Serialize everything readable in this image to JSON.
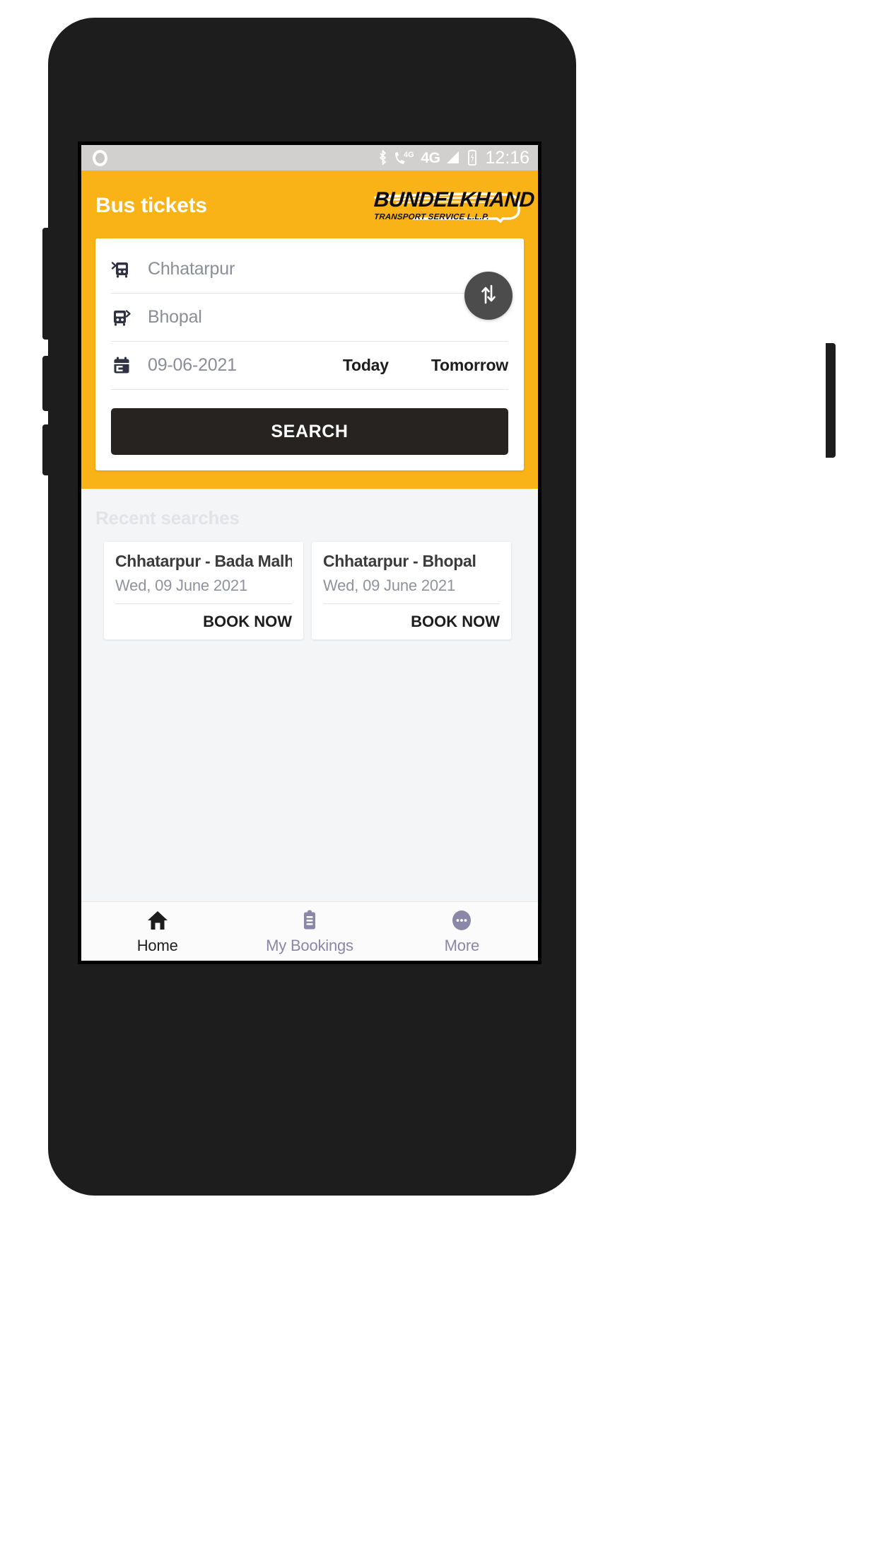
{
  "statusbar": {
    "time": "12:16",
    "network_label_1": "4G",
    "network_label_2": "4G",
    "icons": [
      "camera-circle-icon",
      "bluetooth-icon",
      "call-4g-icon",
      "signal-bars-icon",
      "battery-charging-icon"
    ]
  },
  "header": {
    "title": "Bus tickets",
    "logo_main": "BUNDELKHAND",
    "logo_sub": "TRANSPORT SERVICE L.L.P.",
    "brand_color": "#fab317"
  },
  "search": {
    "from_value": "Chhatarpur",
    "from_icon": "bus-departure-icon",
    "to_value": "Bhopal",
    "to_icon": "bus-arrival-icon",
    "date_value": "09-06-2021",
    "date_icon": "calendar-icon",
    "today_label": "Today",
    "tomorrow_label": "Tomorrow",
    "swap_icon": "swap-vertical-icon",
    "search_label": "SEARCH",
    "search_button_color": "#272320"
  },
  "recent": {
    "title": "Recent searches",
    "book_label": "BOOK NOW",
    "items": [
      {
        "route": "Chhatarpur - Bada Malh...",
        "date": "Wed, 09 June 2021",
        "book": "BOOK NOW"
      },
      {
        "route": "Chhatarpur - Bhopal",
        "date": "Wed, 09 June 2021",
        "book": "BOOK NOW"
      }
    ]
  },
  "bottom_nav": {
    "items": [
      {
        "label": "Home",
        "icon": "home-icon",
        "active": true
      },
      {
        "label": "My Bookings",
        "icon": "clipboard-icon",
        "active": false
      },
      {
        "label": "More",
        "icon": "more-dots-icon",
        "active": false
      }
    ],
    "active_color": "#1d1d1d",
    "inactive_color": "#8b87a8"
  }
}
